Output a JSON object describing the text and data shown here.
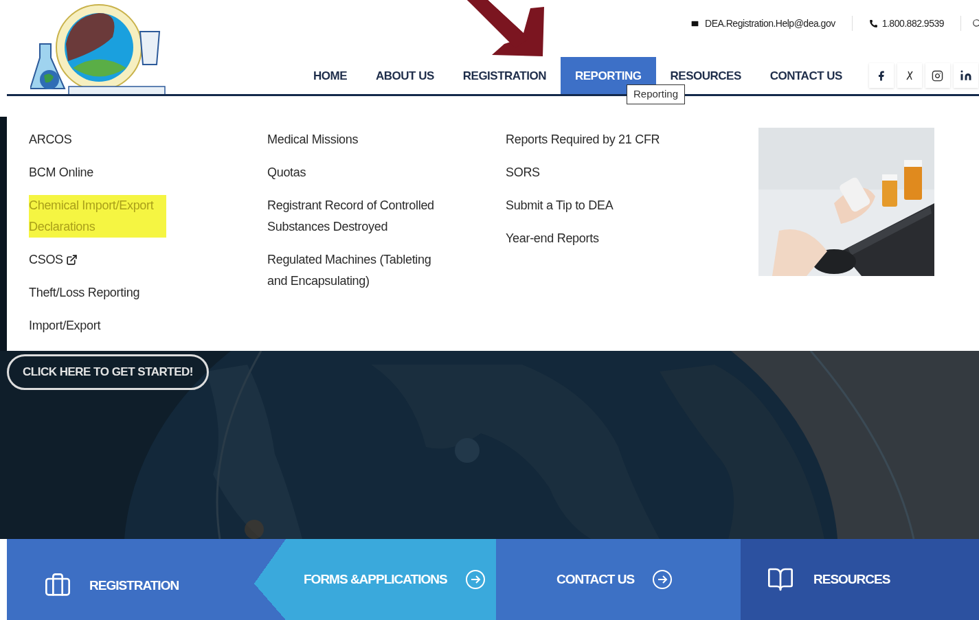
{
  "contact_bar": {
    "email": "DEA.Registration.Help@dea.gov",
    "phone": "1.800.882.9539"
  },
  "nav": [
    {
      "label": "HOME",
      "selected": false
    },
    {
      "label": "ABOUT US",
      "selected": false
    },
    {
      "label": "REGISTRATION",
      "selected": false
    },
    {
      "label": "REPORTING",
      "selected": true
    },
    {
      "label": "RESOURCES",
      "selected": false
    },
    {
      "label": "CONTACT US",
      "selected": false
    }
  ],
  "tooltip": "Reporting",
  "social": [
    {
      "kind": "facebook"
    },
    {
      "kind": "x"
    },
    {
      "kind": "instagram"
    },
    {
      "kind": "linkedin"
    }
  ],
  "menu_columns": [
    [
      {
        "label": "ARCOS",
        "highlighted": false
      },
      {
        "label": "BCM Online",
        "highlighted": false
      },
      {
        "label": "Chemical Import/Export Declarations",
        "highlighted": true
      },
      {
        "label": "CSOS",
        "highlighted": false,
        "external": true
      },
      {
        "label": "Theft/Loss Reporting",
        "highlighted": false
      },
      {
        "label": "Import/Export",
        "highlighted": false
      }
    ],
    [
      {
        "label": "Medical Missions",
        "highlighted": false
      },
      {
        "label": "Quotas",
        "highlighted": false
      },
      {
        "label": "Registrant Record of Controlled Substances Destroyed",
        "highlighted": false
      },
      {
        "label": "Regulated Machines (Tableting and Encapsulating)",
        "highlighted": false
      }
    ],
    [
      {
        "label": "Reports Required by 21 CFR",
        "highlighted": false
      },
      {
        "label": "SORS",
        "highlighted": false
      },
      {
        "label": "Submit a Tip to DEA",
        "highlighted": false
      },
      {
        "label": "Year-end Reports",
        "highlighted": false
      }
    ]
  ],
  "hero": {
    "button": "CLICK HERE TO GET STARTED!"
  },
  "tiles": [
    {
      "label": "REGISTRATION",
      "kind": "briefcase",
      "color": "#3d6fc4"
    },
    {
      "label": "FORMS &APPLICATIONS",
      "kind": "arrow",
      "color": "#3aa9dc"
    },
    {
      "label": "CONTACT US",
      "kind": "arrow",
      "color": "#3d71c5"
    },
    {
      "label": "RESOURCES",
      "kind": "book",
      "color": "#2c51a0"
    }
  ]
}
